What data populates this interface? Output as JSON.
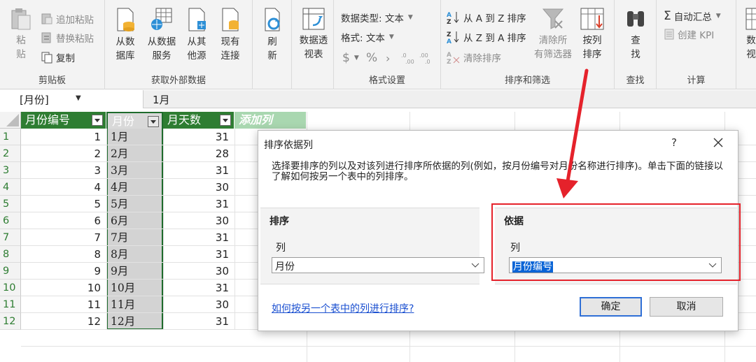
{
  "ribbon": {
    "clipboard": {
      "label": "剪贴板",
      "paste": "粘\n贴",
      "append_paste": "追加粘贴",
      "replace_paste": "替换粘贴",
      "copy": "复制"
    },
    "external": {
      "label": "获取外部数据",
      "from_db": "从数\n据库",
      "from_service": "从数据\n服务",
      "from_other": "从其\n他源",
      "existing": "现有\n连接"
    },
    "refresh": "刷\n新",
    "pivot": "数据透\n视表",
    "format": {
      "label": "格式设置",
      "data_type": "数据类型: 文本",
      "format": "格式: 文本",
      "currency": "$",
      "percent": "%",
      "comma": "›"
    },
    "sortfilter": {
      "label": "排序和筛选",
      "sort_az": "从 A 到 Z 排序",
      "sort_za": "从 Z 到 A 排序",
      "clear_sort": "清除排序",
      "clear_filters": "清除所\n有筛选器",
      "sort_by_col": "按列\n排序"
    },
    "find": {
      "label": "查找",
      "find_btn": "查\n找"
    },
    "calc": {
      "label": "计算",
      "autosum": "自动汇总",
      "kpi": "创建 KPI"
    },
    "more": "数\n视"
  },
  "formula_bar": {
    "name_box": "[月份]",
    "value": "1月"
  },
  "table": {
    "headers": [
      "月份编号",
      "月份",
      "月天数",
      "添加列"
    ],
    "row_numbers": [
      "1",
      "2",
      "3",
      "4",
      "5",
      "6",
      "7",
      "8",
      "9",
      "10",
      "11",
      "12"
    ],
    "rows": [
      [
        "1",
        "1月",
        "31"
      ],
      [
        "2",
        "2月",
        "28"
      ],
      [
        "3",
        "3月",
        "31"
      ],
      [
        "4",
        "4月",
        "30"
      ],
      [
        "5",
        "5月",
        "31"
      ],
      [
        "6",
        "6月",
        "30"
      ],
      [
        "7",
        "7月",
        "31"
      ],
      [
        "8",
        "8月",
        "31"
      ],
      [
        "9",
        "9月",
        "30"
      ],
      [
        "10",
        "10月",
        "31"
      ],
      [
        "11",
        "11月",
        "30"
      ],
      [
        "12",
        "12月",
        "31"
      ]
    ]
  },
  "dialog": {
    "title": "排序依据列",
    "help": "?",
    "description": "选择要排序的列以及对该列进行排序所依据的列(例如，按月份编号对月份名称进行排序)。单击下面的链接以了解如何按另一个表中的列排序。",
    "sort_section": "排序",
    "sort_col_label": "列",
    "sort_col_value": "月份",
    "by_section": "依据",
    "by_col_label": "列",
    "by_col_value": "月份编号",
    "link": "如何按另一个表中的列进行排序?",
    "ok": "确定",
    "cancel": "取消"
  },
  "colors": {
    "table_header": "#2e7d32",
    "annotation": "#e5222b",
    "accent_blue": "#2f6fd6"
  }
}
